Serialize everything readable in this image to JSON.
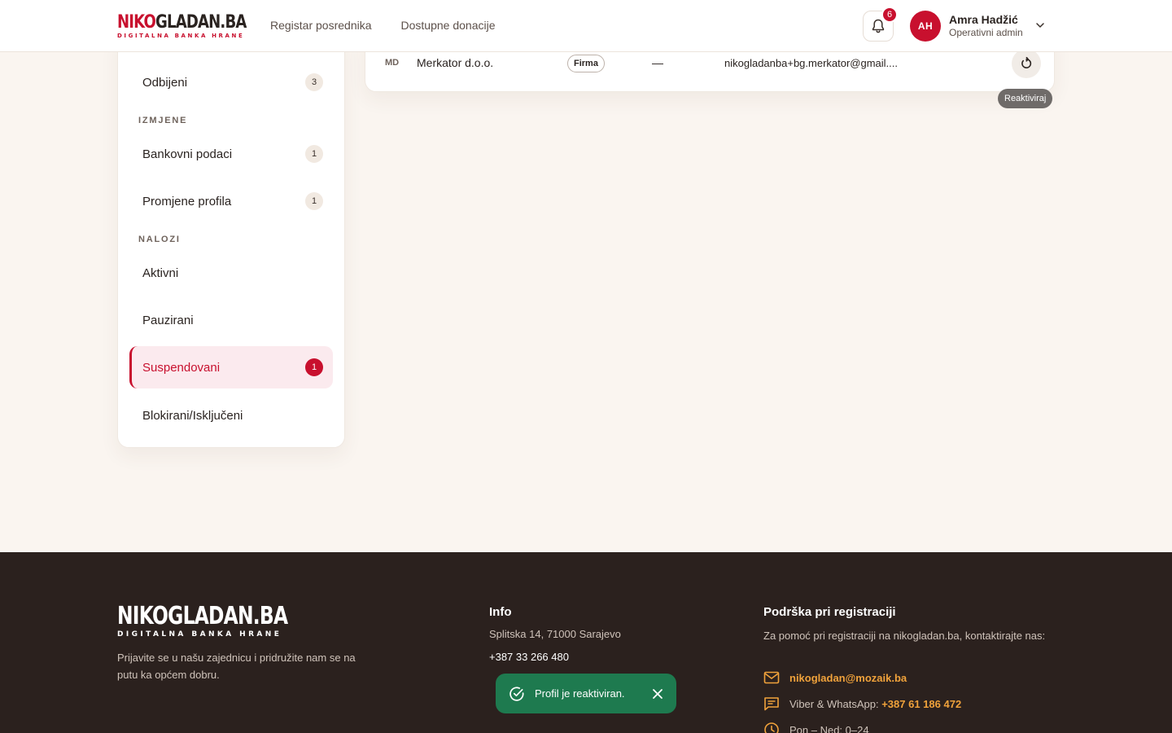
{
  "header": {
    "logo_part1": "NIKO",
    "logo_part2": "GLADAN.BA",
    "logo_tagline": "DIGITALNA BANKA HRANE",
    "nav": [
      "Registar posrednika",
      "Dostupne donacije"
    ],
    "notifications_count": "6",
    "user": {
      "initials": "AH",
      "name": "Amra Hadžić",
      "role": "Operativni admin"
    }
  },
  "sidebar": {
    "items_top": [
      {
        "label": "Odbijeni",
        "count": "3"
      }
    ],
    "section_changes": "IZMJENE",
    "items_changes": [
      {
        "label": "Bankovni podaci",
        "count": "1"
      },
      {
        "label": "Promjene profila",
        "count": "1"
      }
    ],
    "section_accounts": "NALOZI",
    "items_accounts": [
      {
        "label": "Aktivni",
        "count": ""
      },
      {
        "label": "Pauzirani",
        "count": ""
      },
      {
        "label": "Suspendovani",
        "count": "1"
      },
      {
        "label": "Blokirani/Isključeni",
        "count": ""
      }
    ]
  },
  "table": {
    "row": {
      "initials": "MD",
      "name": "Merkator d.o.o.",
      "type": "Firma",
      "dash": "—",
      "email": "nikogladanba+bg.merkator@gmail...."
    },
    "action_tooltip": "Reaktiviraj"
  },
  "footer": {
    "logo": "NIKOGLADAN.BA",
    "logo_tagline": "DIGITALNA BANKA HRANE",
    "tagline": "Prijavite se u našu zajednicu i pridružite nam se na putu ka općem dobru.",
    "info_title": "Info",
    "address": "Splitska 14, 71000 Sarajevo",
    "phone": "+387 33 266 480",
    "support_title": "Podrška pri registraciji",
    "support_text": "Za pomoć pri registraciji na nikogladan.ba, kontaktirajte nas:",
    "email": "nikogladan@mozaik.ba",
    "viber_label": "Viber & WhatsApp:",
    "viber_number": "+387 61 186 472",
    "hours": "Pon – Ned: 0–24"
  },
  "toast": {
    "message": "Profil je reaktiviran."
  },
  "colors": {
    "brand_red": "#c8102e",
    "footer_bg": "#2b211e",
    "accent_orange": "#f0a23b",
    "toast_green": "#1e7a4f",
    "page_bg": "#faf5f0"
  }
}
